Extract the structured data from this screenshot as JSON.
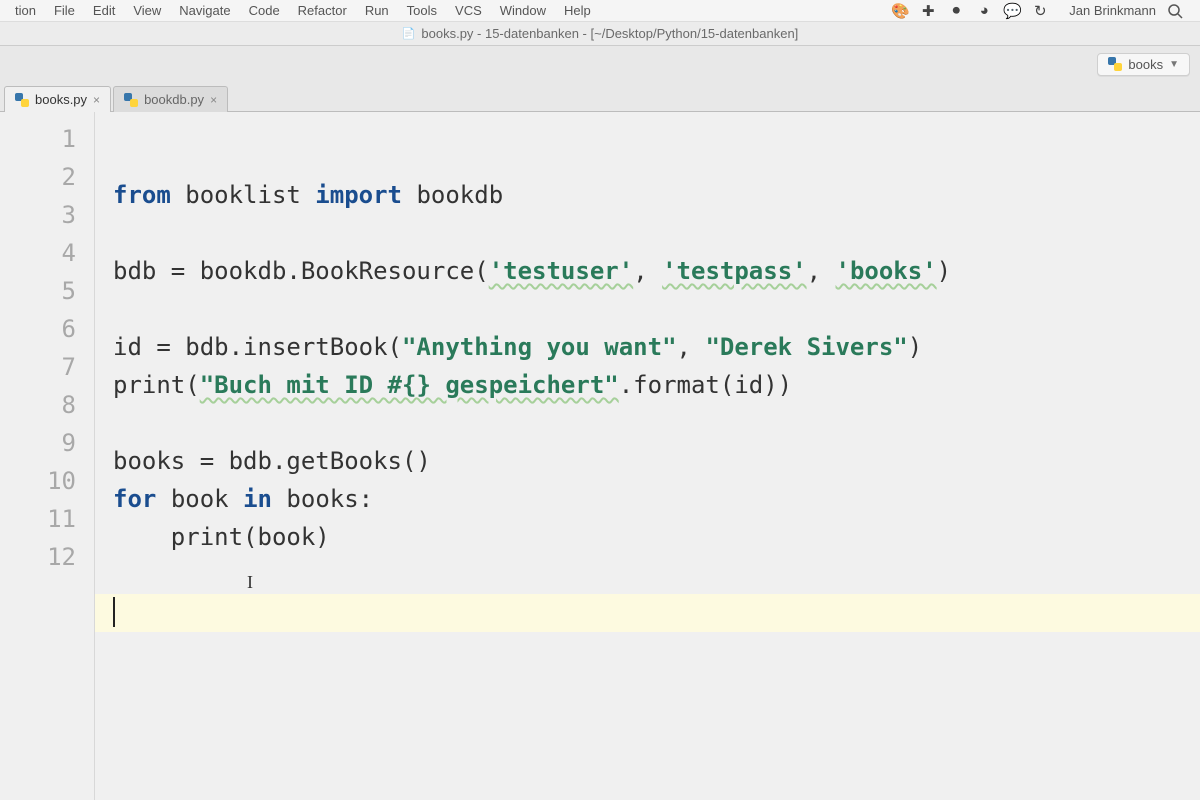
{
  "menubar": {
    "items": [
      "tion",
      "File",
      "Edit",
      "View",
      "Navigate",
      "Code",
      "Refactor",
      "Run",
      "Tools",
      "VCS",
      "Window",
      "Help"
    ],
    "user": "Jan Brinkmann"
  },
  "titlebar": {
    "text": "books.py - 15-datenbanken - [~/Desktop/Python/15-datenbanken]"
  },
  "run_config": {
    "label": "books"
  },
  "tabs": [
    {
      "label": "books.py",
      "active": true
    },
    {
      "label": "bookdb.py",
      "active": false
    }
  ],
  "gutter": {
    "start": 1,
    "end": 12
  },
  "code_lines": [
    {
      "tokens": [
        {
          "t": "kw",
          "v": "from"
        },
        {
          "t": "sp",
          "v": " "
        },
        {
          "t": "id",
          "v": "booklist"
        },
        {
          "t": "sp",
          "v": " "
        },
        {
          "t": "kw",
          "v": "import"
        },
        {
          "t": "sp",
          "v": " "
        },
        {
          "t": "id",
          "v": "bookdb"
        }
      ]
    },
    {
      "tokens": []
    },
    {
      "tokens": [
        {
          "t": "id",
          "v": "bdb = bookdb.BookResource("
        },
        {
          "t": "strw",
          "v": "'testuser'"
        },
        {
          "t": "id",
          "v": ", "
        },
        {
          "t": "strw",
          "v": "'testpass'"
        },
        {
          "t": "id",
          "v": ", "
        },
        {
          "t": "strw",
          "v": "'books'"
        },
        {
          "t": "id",
          "v": ")"
        }
      ]
    },
    {
      "tokens": []
    },
    {
      "tokens": [
        {
          "t": "id",
          "v": "id = bdb.insertBook("
        },
        {
          "t": "str",
          "v": "\"Anything you want\""
        },
        {
          "t": "id",
          "v": ", "
        },
        {
          "t": "str",
          "v": "\"Derek Sivers\""
        },
        {
          "t": "id",
          "v": ")"
        }
      ]
    },
    {
      "tokens": [
        {
          "t": "id",
          "v": "print("
        },
        {
          "t": "strw",
          "v": "\"Buch mit ID #{} gespeichert\""
        },
        {
          "t": "id",
          "v": ".format(id))"
        }
      ]
    },
    {
      "tokens": []
    },
    {
      "tokens": [
        {
          "t": "id",
          "v": "books = bdb.getBooks()"
        }
      ]
    },
    {
      "tokens": [
        {
          "t": "kw",
          "v": "for"
        },
        {
          "t": "sp",
          "v": " "
        },
        {
          "t": "id",
          "v": "book"
        },
        {
          "t": "sp",
          "v": " "
        },
        {
          "t": "kw",
          "v": "in"
        },
        {
          "t": "sp",
          "v": " "
        },
        {
          "t": "id",
          "v": "books:"
        }
      ]
    },
    {
      "tokens": [
        {
          "t": "sp",
          "v": "    "
        },
        {
          "t": "id",
          "v": "print(book)"
        }
      ]
    },
    {
      "tokens": []
    },
    {
      "tokens": [],
      "current": true,
      "caret": true
    }
  ]
}
